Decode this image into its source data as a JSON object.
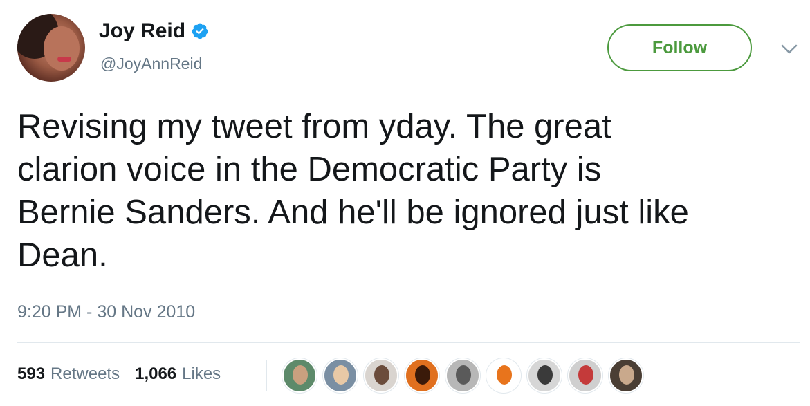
{
  "user": {
    "display_name": "Joy Reid",
    "handle": "@JoyAnnReid",
    "verified_icon": "verified-badge-icon"
  },
  "header": {
    "follow_label": "Follow",
    "more_icon": "chevron-down-icon"
  },
  "tweet": {
    "text": "Revising my tweet from yday. The great\nclarion voice in the Democratic Party is\nBernie Sanders. And he'll be ignored just like\nDean.",
    "timestamp": "9:20 PM - 30 Nov 2010"
  },
  "stats": {
    "retweets_count": "593",
    "retweets_label": "Retweets",
    "likes_count": "1,066",
    "likes_label": "Likes"
  },
  "colors": {
    "follow_green": "#4c9a3e",
    "verified_blue": "#1da1f2",
    "secondary_text": "#657786",
    "divider": "#e1e8ed"
  },
  "liker_avatars": [
    {
      "bg": "#5d8a6a",
      "fg": "#c9a07f"
    },
    {
      "bg": "#7a8fa3",
      "fg": "#e8c9a6"
    },
    {
      "bg": "#d9d4cf",
      "fg": "#6b4c3b"
    },
    {
      "bg": "#e0701f",
      "fg": "#3a1a0a"
    },
    {
      "bg": "#b7b7b7",
      "fg": "#5a5a5a"
    },
    {
      "bg": "#ffffff",
      "fg": "#e8741c"
    },
    {
      "bg": "#d6d6d6",
      "fg": "#3a3a3a"
    },
    {
      "bg": "#cfcfcf",
      "fg": "#c43a3a"
    },
    {
      "bg": "#4a3e34",
      "fg": "#c9a98c"
    }
  ]
}
